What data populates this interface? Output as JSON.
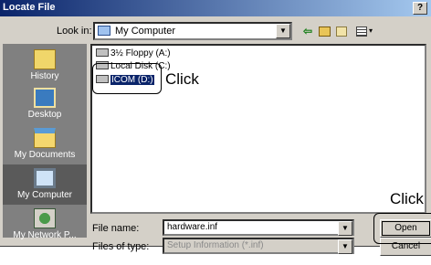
{
  "window": {
    "title": "Locate File",
    "help_label": "?"
  },
  "lookin": {
    "label": "Look in:",
    "value": "My Computer",
    "arrow": "▼"
  },
  "toolbar": {
    "back_icon": "back-arrow-icon",
    "up_icon": "up-folder-icon",
    "new_folder_icon": "new-folder-icon",
    "view_menu_icon": "view-menu-icon",
    "back_glyph": "⇦",
    "view_arrow": "▾"
  },
  "places": [
    {
      "label": "History",
      "icon": "history-icon"
    },
    {
      "label": "Desktop",
      "icon": "desktop-icon"
    },
    {
      "label": "My Documents",
      "icon": "my-documents-icon"
    },
    {
      "label": "My Computer",
      "icon": "my-computer-icon"
    },
    {
      "label": "My Network P...",
      "icon": "network-places-icon"
    }
  ],
  "files": [
    {
      "name": "3½ Floppy (A:)",
      "icon": "floppy-drive-icon"
    },
    {
      "name": "Local Disk (C:)",
      "icon": "hard-disk-icon"
    },
    {
      "name": "ICOM (D:)",
      "icon": "cd-drive-icon",
      "selected": true
    }
  ],
  "annotations": {
    "callout_1": "Click",
    "callout_2": "Click"
  },
  "file_name": {
    "label": "File name:",
    "value": "hardware.inf",
    "arrow": "▼"
  },
  "file_type": {
    "label": "Files of type:",
    "value": "Setup Information (*.inf)",
    "arrow": "▼"
  },
  "buttons": {
    "open": "Open",
    "cancel": "Cancel"
  },
  "colors": {
    "titlebar": "#0a246a",
    "dialog_bg": "#d4d0c8",
    "places_bg": "#808080",
    "selection": "#0a246a"
  }
}
